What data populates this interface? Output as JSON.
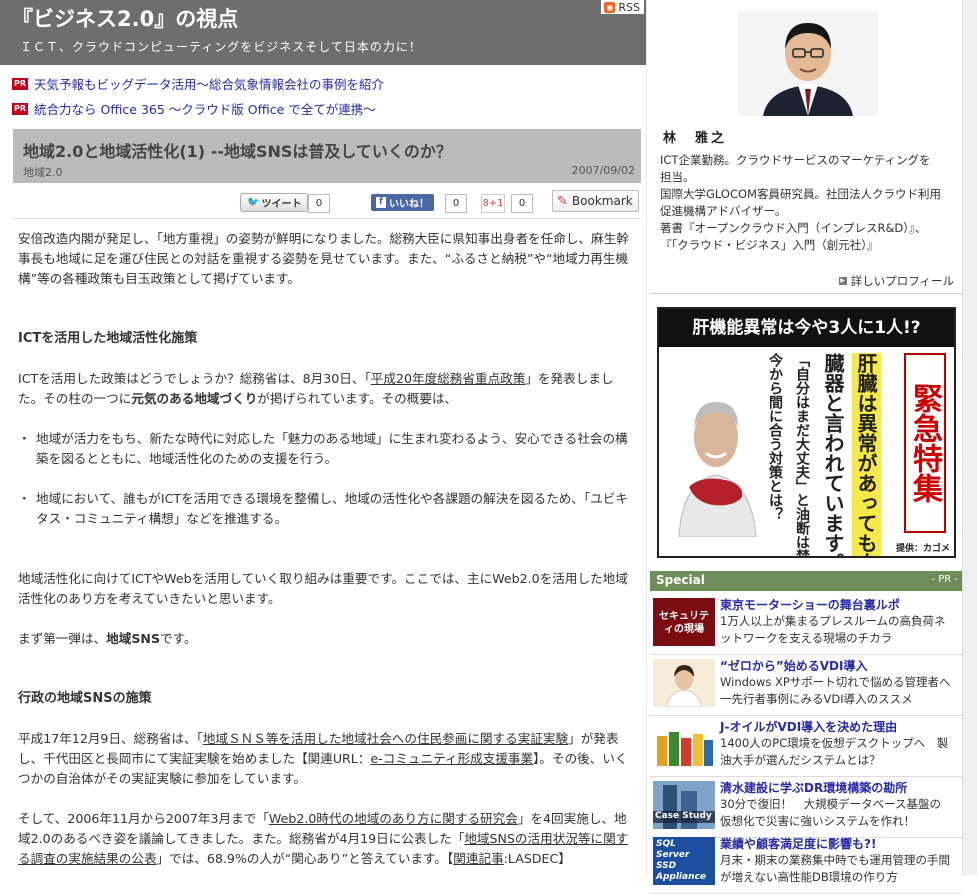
{
  "blog": {
    "title": "『ビジネス2.0』の視点",
    "subtitle": "ＩＣＴ、クラウドコンピューティングをビジネスそして日本の力に！",
    "rss_label": "RSS"
  },
  "pr_links": [
    {
      "badge": "PR",
      "text": "天気予報もビッグデータ活用～総合気象情報会社の事例を紹介"
    },
    {
      "badge": "PR",
      "text": "統合力なら Office 365 ～クラウド版 Office で全てが連携～"
    }
  ],
  "post": {
    "title": "地域2.0と地域活性化(1) --地域SNSは普及していくのか？",
    "category": "地域2.0",
    "date": "2007/09/02"
  },
  "share": {
    "tweet_label": "ツイート",
    "tweet_count": "0",
    "like_label": "いいね！",
    "like_count": "0",
    "gplus_label": "8+1",
    "gplus_count": "0",
    "bookmark_label": "Bookmark"
  },
  "article": {
    "p1": "安倍改造内閣が発足し、「地方重視」の姿勢が鮮明になりました。総務大臣に県知事出身者を任命し、麻生幹事長も地域に足を運び住民との対話を重視する姿勢を見せています。また、“ふるさと納税”や“地域力再生機構”等の各種政策も目玉政策として掲げています。",
    "h1": "ICTを活用した地域活性化施策",
    "p2_a": "ICTを活用した政策はどうでしょうか？総務省は、8月30日、「",
    "p2_link": "平成20年度総務省重点政策",
    "p2_b": "」を発表しました。その柱の一つに",
    "p2_bold": "元気のある地域づくり",
    "p2_c": "が掲げられています。その概要は、",
    "li1": "地域が活力をもち、新たな時代に対応した「魅力のある地域」に生まれ変わるよう、安心できる社会の構築を図るとともに、地域活性化のための支援を行う。",
    "li2": "地域において、誰もがICTを活用できる環境を整備し、地域の活性化や各課題の解決を図るため、「ユビキタス・コミュニティ構想」などを推進する。",
    "p3": "地域活性化に向けてICTやWebを活用していく取り組みは重要です。ここでは、主にWeb2.0を活用した地域活性化のあり方を考えていきたいと思います。",
    "p4_a": "まず第一弾は、",
    "p4_bold": "地域SNS",
    "p4_b": "です。",
    "h2": "行政の地域SNSの施策",
    "p5_a": "平成17年12月9日、総務省は、「",
    "p5_link1": "地域ＳＮＳ等を活用した地域社会への住民参画に関する実証実験",
    "p5_b": "」が発表し、千代田区と長岡市にて実証実験を始めました【関連URL：",
    "p5_link2": "e-コミュニティ形成支援事業",
    "p5_c": "】。その後、いくつかの自治体がその実証実験に参加をしています。",
    "p6_a": "そして、2006年11月から2007年3月まで「",
    "p6_link1": "Web2.0時代の地域のあり方に関する研究会",
    "p6_b": "」を4回実施し、地域2.0のあるべき姿を議論してきました。また。総務省が4月19日に公表した「",
    "p6_link2": "地域SNSの活用状況等に関する調査の実施結果の公表",
    "p6_c": "」では、68.9%の人が“関心あり”と答えています。【",
    "p6_link3": "関連記事",
    "p6_d": ":LASDEC】"
  },
  "profile": {
    "name": "林　雅之",
    "bio_lines": [
      "ICT企業勤務。クラウドサービスのマーケティングを",
      "担当。",
      "国際大学GLOCOM客員研究員。社団法人クラウド利用",
      "促進機構アドバイザー。",
      "著書『オープンクラウド入門（インプレスR&D）』、",
      "『「クラウド・ビジネス」入門（創元社）』"
    ],
    "profile_link": "詳しいプロフィール"
  },
  "ad": {
    "headline": "肝機能異常は今や3人に1人!?",
    "col1": "今から間に合う対策とは？",
    "col2": "「自分はまだ大丈夫」と油断は禁物です。",
    "col3": "臓器と言われています。",
    "col4": "肝臓は異常があっても自覚症状が出にくい",
    "urgent": "緊急特集",
    "sponsor": "提供：カゴメ"
  },
  "special": {
    "header": "Special",
    "pr": "- PR -",
    "items": [
      {
        "thumb_label": "セキュリティの現場",
        "title": "東京モーターショーの舞台裏ルポ",
        "lines": [
          "1万人以上が集まるプレスルームの高負荷ネ",
          "ットワークを支える現場のチカラ"
        ]
      },
      {
        "thumb_label": "",
        "title": "“ゼロから”始めるVDI導入",
        "lines": [
          "Windows XPサポート切れで悩める管理者へ",
          "一先行者事例にみるVDI導入のススメ"
        ]
      },
      {
        "thumb_label": "",
        "title": "J-オイルがVDI導入を決めた理由",
        "lines": [
          "1400人のPC環境を仮想デスクトップへ　製",
          "油大手が選んだシステムとは？"
        ]
      },
      {
        "thumb_label": "Case Study",
        "title": "清水建設に学ぶDR環境構築の勘所",
        "lines": [
          "30分で復旧！　大規模データベース基盤の",
          "仮想化で災害に強いシステムを作れ！"
        ]
      },
      {
        "thumb_label": "SQL Server SSD Appliance",
        "title": "業績や顧客満足度に影響も?!",
        "lines": [
          "月末・期末の業務集中時でも運用管理の手間",
          "が増えない高性能DB環境の作り方"
        ]
      }
    ]
  },
  "colors": {
    "header_bg": "#6e6e6e",
    "post_head_bg": "#bbbbbb",
    "special_bg": "#6d8d5b",
    "link_blue": "#2a2aa8",
    "pr_red": "#c4001c"
  }
}
